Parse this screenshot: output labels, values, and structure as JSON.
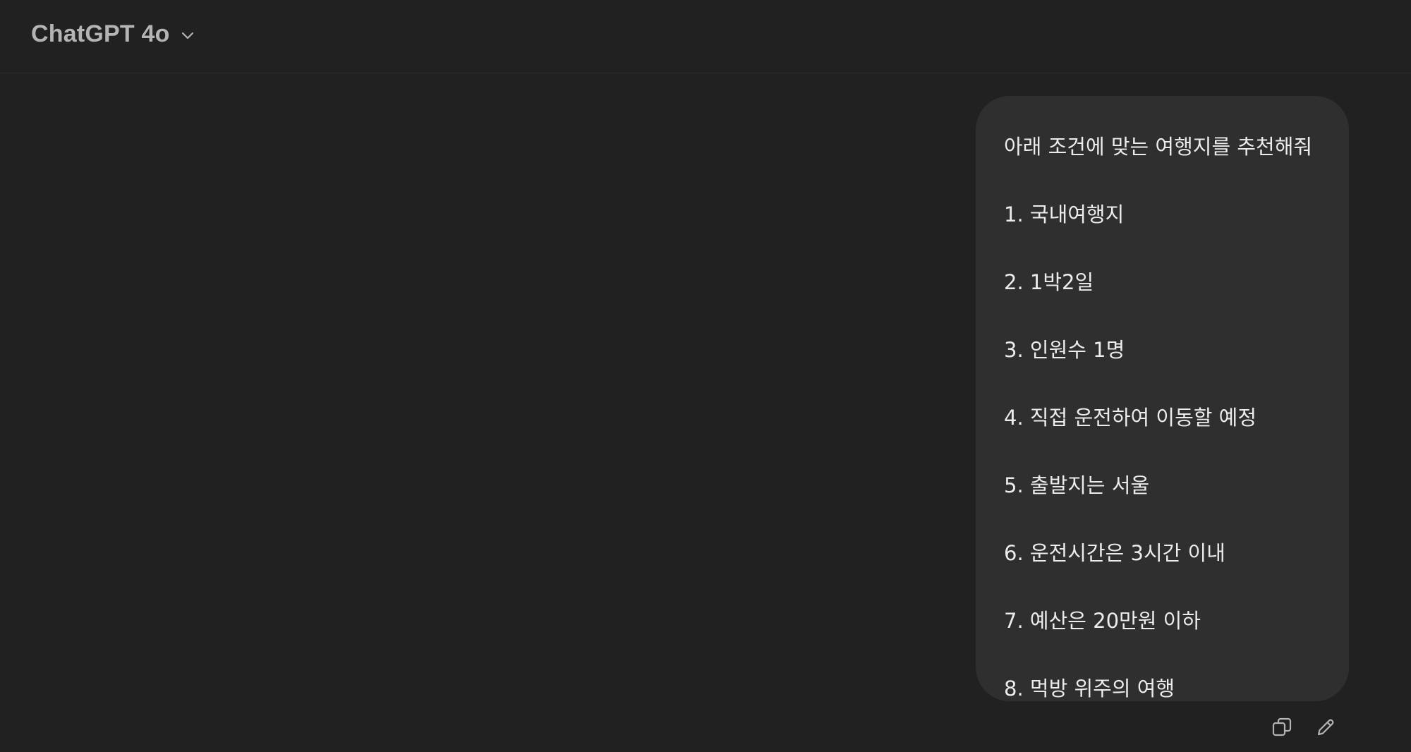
{
  "header": {
    "model_title": "ChatGPT 4o"
  },
  "conversation": {
    "user_message": {
      "lines": [
        "아래 조건에 맞는 여행지를 추천해줘",
        "1. 국내여행지",
        "2. 1박2일",
        "3. 인원수 1명",
        "4. 직접 운전하여 이동할 예정",
        "5. 출발지는 서울",
        "6. 운전시간은 3시간 이내",
        "7. 예산은 20만원 이하",
        "8. 먹방 위주의 여행"
      ],
      "actions": [
        {
          "icon": "copy-icon"
        },
        {
          "icon": "edit-pencil-icon"
        }
      ]
    }
  },
  "colors": {
    "background": "#212121",
    "bubble": "#2f2f2f",
    "text": "#ececec",
    "muted": "#b4b4b4"
  }
}
